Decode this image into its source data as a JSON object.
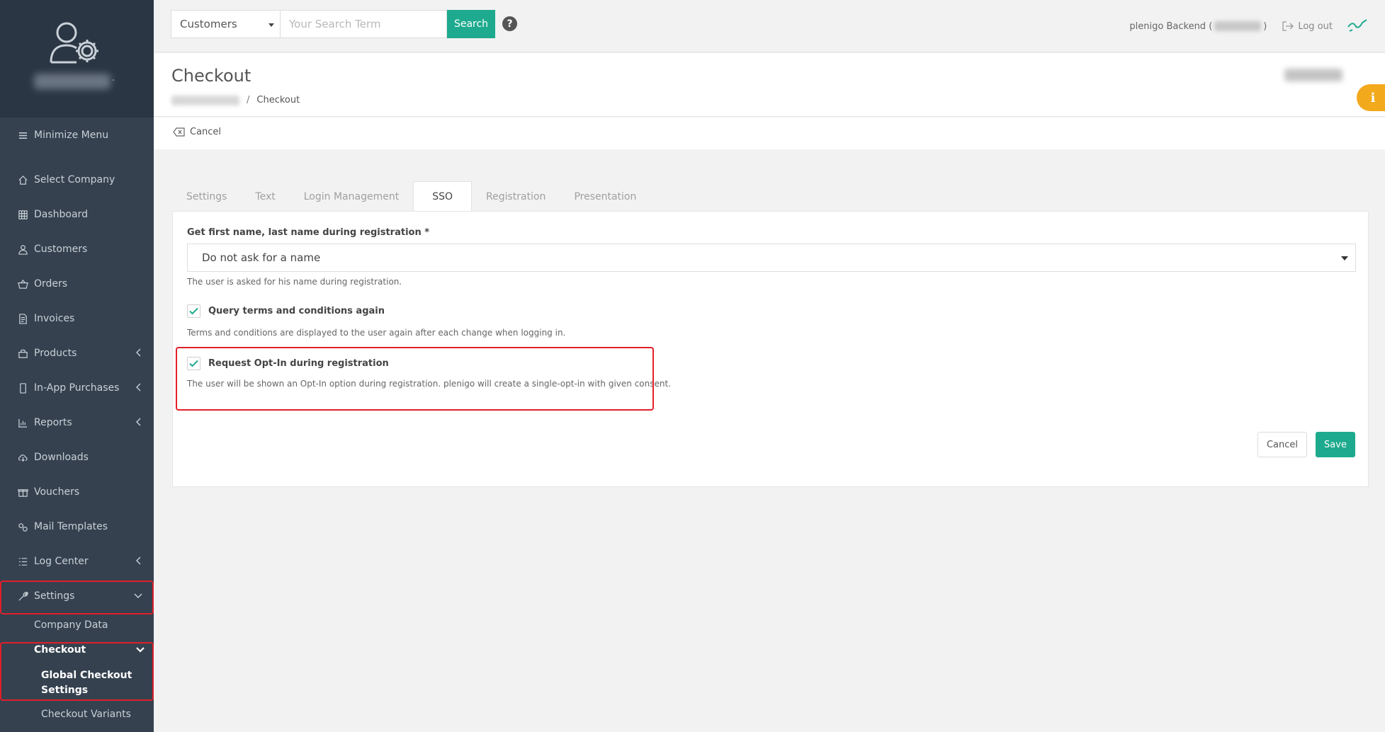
{
  "sidebar": {
    "minimize_label": "Minimize Menu",
    "items": [
      {
        "label": "Select Company",
        "icon": "home-icon"
      },
      {
        "label": "Dashboard",
        "icon": "grid-icon"
      },
      {
        "label": "Customers",
        "icon": "user-icon"
      },
      {
        "label": "Orders",
        "icon": "basket-icon"
      },
      {
        "label": "Invoices",
        "icon": "document-icon"
      },
      {
        "label": "Products",
        "icon": "bag-icon"
      },
      {
        "label": "In-App Purchases",
        "icon": "phone-icon"
      },
      {
        "label": "Reports",
        "icon": "chart-icon"
      },
      {
        "label": "Downloads",
        "icon": "cloud-download-icon"
      },
      {
        "label": "Vouchers",
        "icon": "gift-icon"
      },
      {
        "label": "Mail Templates",
        "icon": "gears-icon"
      },
      {
        "label": "Log Center",
        "icon": "list-icon"
      },
      {
        "label": "Settings",
        "icon": "wrench-icon"
      }
    ],
    "sub_items": {
      "company_data": "Company Data",
      "checkout": "Checkout",
      "global_checkout_line1": "Global Checkout",
      "global_checkout_line2": "Settings",
      "checkout_variants": "Checkout Variants"
    }
  },
  "topbar": {
    "search_scope": "Customers",
    "search_placeholder": "Your Search Term",
    "search_button": "Search",
    "help": "?",
    "user_label": "plenigo Backend (",
    "user_suffix": ")",
    "logout": "Log out"
  },
  "header": {
    "title": "Checkout",
    "breadcrumb_current": "Checkout",
    "breadcrumb_sep": "/",
    "info": "i"
  },
  "actions": {
    "cancel": "Cancel"
  },
  "tabs": [
    {
      "label": "Settings"
    },
    {
      "label": "Text"
    },
    {
      "label": "Login Management"
    },
    {
      "label": "SSO",
      "active": true
    },
    {
      "label": "Registration"
    },
    {
      "label": "Presentation"
    }
  ],
  "form": {
    "name_label": "Get first name, last name during registration *",
    "name_value": "Do not ask for a name",
    "name_help": "The user is asked for his name during registration.",
    "terms_label": "Query terms and conditions again",
    "terms_checked": true,
    "terms_help": "Terms and conditions are displayed to the user again after each change when logging in.",
    "optin_label": "Request Opt-In during registration",
    "optin_checked": true,
    "optin_help": "The user will be shown an Opt-In option during registration. plenigo will create a single-opt-in with given consent.",
    "cancel_button": "Cancel",
    "save_button": "Save"
  },
  "colors": {
    "sidebar_bg": "#35414f",
    "accent_green": "#1eaa8e",
    "highlight_red": "#e0202a",
    "info_orange": "#f2a91c"
  }
}
